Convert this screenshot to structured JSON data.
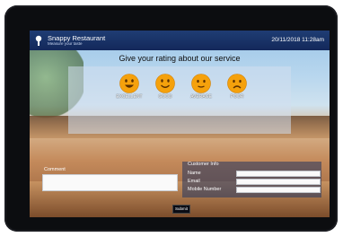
{
  "header": {
    "app_name": "Snappy Restaurant",
    "tagline": "Measure your taste",
    "datetime": "20/11/2018 11:28am"
  },
  "rating": {
    "title": "Give your rating about our service",
    "options": [
      {
        "label": "EXCELLENT",
        "icon": "very-happy-face-icon"
      },
      {
        "label": "GOOD",
        "icon": "happy-face-icon"
      },
      {
        "label": "AVERAGE",
        "icon": "smiling-face-icon"
      },
      {
        "label": "POOR",
        "icon": "sad-face-icon"
      }
    ]
  },
  "comment": {
    "label": "Comment",
    "value": ""
  },
  "customer_info": {
    "title": "Customer Info",
    "fields": [
      {
        "label": "Name",
        "value": ""
      },
      {
        "label": "Email",
        "value": ""
      },
      {
        "label": "Mobile Number",
        "value": ""
      }
    ]
  },
  "actions": {
    "submit_label": "Submit"
  },
  "colors": {
    "header_bar": "#1f3d74",
    "emoji": "#f5a10c",
    "panel": "#d2deee"
  }
}
